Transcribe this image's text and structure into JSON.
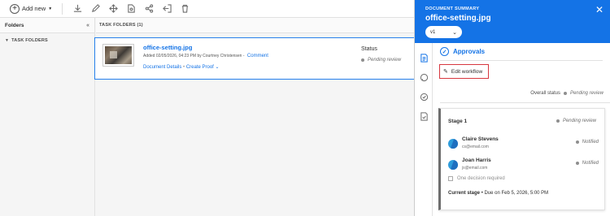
{
  "toolbar": {
    "add_new_label": "Add new",
    "icons": [
      "download-icon",
      "pencil-icon",
      "move-icon",
      "document-search-icon",
      "share-icon",
      "exit-icon",
      "trash-icon"
    ]
  },
  "folders": {
    "title": "Folders",
    "tree_root": "TASK FOLDERS"
  },
  "main": {
    "header": "TASK FOLDERS (1)",
    "document": {
      "name": "office-setting.jpg",
      "meta": "Added 02/05/2026, 04:23 PM by Courtney Christensen -",
      "comment_link": "Comment",
      "details_link": "Document Details",
      "proof_link": "Create Proof",
      "status_label": "Status",
      "status_value": "Pending review"
    }
  },
  "panel": {
    "label": "DOCUMENT SUMMARY",
    "title": "office-setting.jpg",
    "version": "v1",
    "section_title": "Approvals",
    "edit_workflow": "Edit workflow",
    "overall_label": "Overall status",
    "overall_value": "Pending review",
    "stage": {
      "title": "Stage 1",
      "status": "Pending review",
      "approvers": [
        {
          "name": "Claire Stevens",
          "email": "cs@email.com",
          "status": "Notified"
        },
        {
          "name": "Joan Harris",
          "email": "js@email.com",
          "status": "Notified"
        }
      ],
      "decision_label": "One decision required",
      "current_label": "Current stage",
      "current_due": "• Due on Feb 5, 2026, 5:00 PM"
    }
  },
  "colors": {
    "accent": "#1473e6",
    "highlight_border": "#d7373f"
  }
}
